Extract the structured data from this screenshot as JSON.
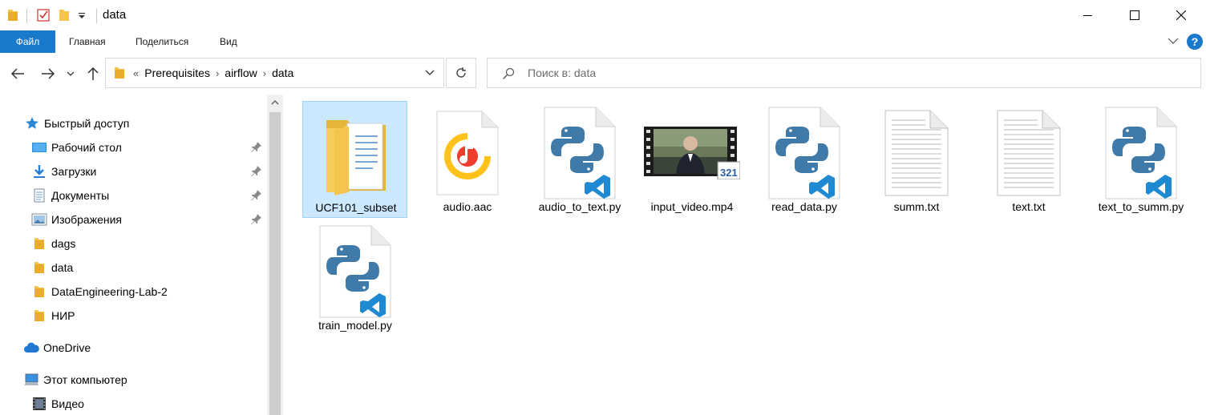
{
  "window": {
    "title": "data",
    "minimize_label": "—",
    "maximize_label": "☐",
    "close_label": "✕"
  },
  "ribbon": {
    "tabs": [
      {
        "label": "Файл"
      },
      {
        "label": "Главная"
      },
      {
        "label": "Поделиться"
      },
      {
        "label": "Вид"
      }
    ],
    "help_label": "?"
  },
  "address": {
    "overflow": "«",
    "crumbs": [
      "Prerequisites",
      "airflow",
      "data"
    ]
  },
  "search": {
    "placeholder": "Поиск в: data"
  },
  "sidebar": {
    "items": [
      {
        "label": "Быстрый доступ",
        "icon": "star-icon"
      },
      {
        "label": "Рабочий стол",
        "icon": "desktop-icon",
        "pinned": true
      },
      {
        "label": "Загрузки",
        "icon": "download-icon",
        "pinned": true
      },
      {
        "label": "Документы",
        "icon": "documents-icon",
        "pinned": true
      },
      {
        "label": "Изображения",
        "icon": "pictures-icon",
        "pinned": true
      },
      {
        "label": "dags",
        "icon": "folder-icon"
      },
      {
        "label": "data",
        "icon": "folder-icon"
      },
      {
        "label": "DataEngineering-Lab-2",
        "icon": "folder-icon"
      },
      {
        "label": "НИР",
        "icon": "folder-icon"
      },
      {
        "label": "OneDrive",
        "icon": "cloud-icon"
      },
      {
        "label": "Этот компьютер",
        "icon": "computer-icon"
      },
      {
        "label": "Видео",
        "icon": "video-icon"
      }
    ]
  },
  "files": [
    {
      "name": "UCF101_subset",
      "type": "folder",
      "selected": true
    },
    {
      "name": "audio.aac",
      "type": "audio"
    },
    {
      "name": "audio_to_text.py",
      "type": "python"
    },
    {
      "name": "input_video.mp4",
      "type": "video"
    },
    {
      "name": "read_data.py",
      "type": "python"
    },
    {
      "name": "summ.txt",
      "type": "text"
    },
    {
      "name": "text.txt",
      "type": "text"
    },
    {
      "name": "text_to_summ.py",
      "type": "python"
    },
    {
      "name": "train_model.py",
      "type": "python"
    }
  ],
  "colors": {
    "accent": "#1979ca",
    "selection": "#cce8ff",
    "folder": "#f3c64b",
    "python_blue": "#3f7aa8",
    "vscode_blue": "#1f8ad2"
  }
}
